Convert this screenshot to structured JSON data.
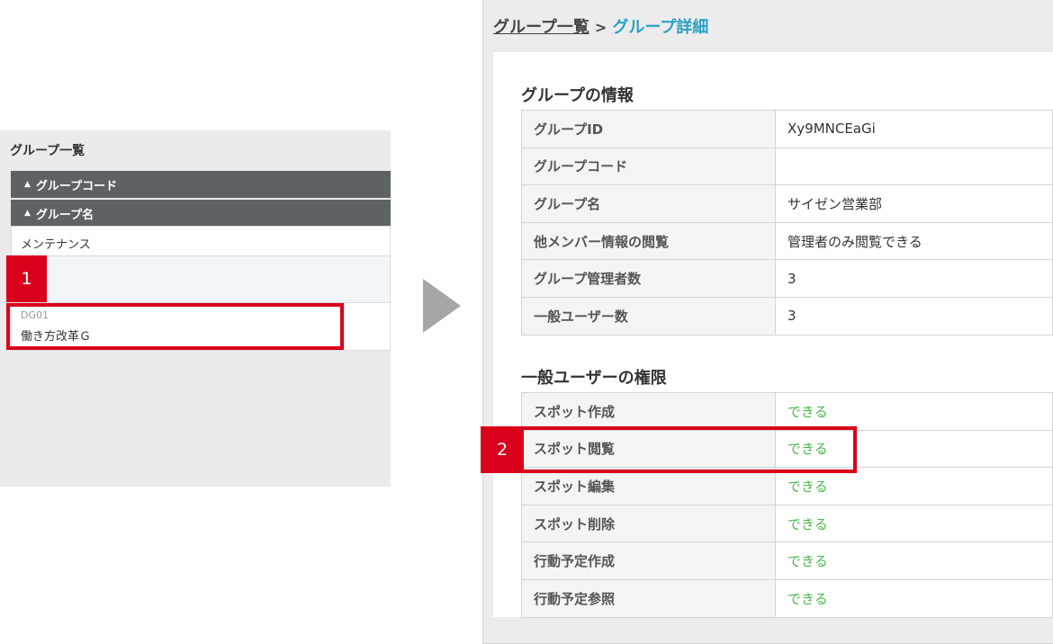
{
  "left": {
    "title": "グループ一覧",
    "sort_headers": [
      {
        "label": "グループコード",
        "icon": "sort-both-icon"
      },
      {
        "label": "グループ名",
        "icon": "sort-asc-icon"
      }
    ],
    "rows": [
      {
        "name": "メンテナンス"
      },
      {
        "code": "DG01",
        "name": "働き方改革Ｇ"
      }
    ],
    "badge": "1"
  },
  "right": {
    "breadcrumb": {
      "link": "グループ一覧",
      "separator": ">",
      "current": "グループ詳細"
    },
    "info_title": "グループの情報",
    "info_rows": [
      {
        "label": "グループID",
        "value": "Xy9MNCEaGi"
      },
      {
        "label": "グループコード",
        "value": ""
      },
      {
        "label": "グループ名",
        "value": "サイゼン営業部"
      },
      {
        "label": "他メンバー情報の閲覧",
        "value": "管理者のみ閲覧できる"
      },
      {
        "label": "グループ管理者数",
        "value": "3"
      },
      {
        "label": "一般ユーザー数",
        "value": "3"
      }
    ],
    "perm_title": "一般ユーザーの権限",
    "perm_rows": [
      {
        "label": "スポット作成",
        "value": "できる"
      },
      {
        "label": "スポット閲覧",
        "value": "できる"
      },
      {
        "label": "スポット編集",
        "value": "できる"
      },
      {
        "label": "スポット削除",
        "value": "できる"
      },
      {
        "label": "行動予定作成",
        "value": "できる"
      },
      {
        "label": "行動予定参照",
        "value": "できる"
      }
    ],
    "badge": "2"
  },
  "colors": {
    "accent": "#2aa1c5",
    "highlight": "#d9001b",
    "ok": "#4db84d",
    "header_bg": "#5d6264"
  }
}
